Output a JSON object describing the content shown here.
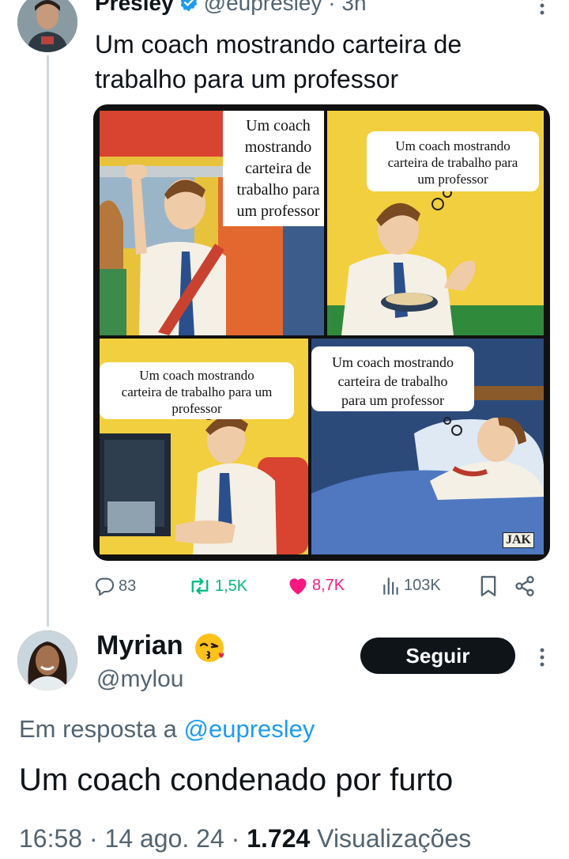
{
  "post": {
    "author_name": "Presley",
    "handle": "@eupresley",
    "time": "3h",
    "text": "Um coach mostrando carteira de trabalho para um professor",
    "image": {
      "signature": "JAK",
      "panels": [
        {
          "bubble": [
            "Um coach",
            "mostrando",
            "carteira de",
            "trabalho para",
            "um professor"
          ]
        },
        {
          "bubble": [
            "Um coach mostrando",
            "carteira de trabalho para",
            "um professor"
          ]
        },
        {
          "bubble": [
            "Um coach mostrando",
            "carteira de trabalho para um",
            "professor"
          ]
        },
        {
          "bubble": [
            "Um coach mostrando",
            "carteira de trabalho",
            "para um professor"
          ]
        }
      ]
    },
    "stats": {
      "replies": "83",
      "reposts": "1,5K",
      "likes": "8,7K",
      "views": "103K"
    }
  },
  "reply": {
    "author_name": "Myrian",
    "handle": "@mylou",
    "follow_label": "Seguir",
    "in_reply_prefix": "Em resposta a",
    "in_reply_handle": "@eupresley",
    "text": "Um coach condenado por furto",
    "time": "16:58",
    "date": "14 ago. 24",
    "views_count": "1.724",
    "views_label": "Visualizações"
  },
  "colors": {
    "like": "#f91880",
    "link": "#1d9bf0",
    "verified": "#1d9bf0",
    "muted": "#536471"
  }
}
